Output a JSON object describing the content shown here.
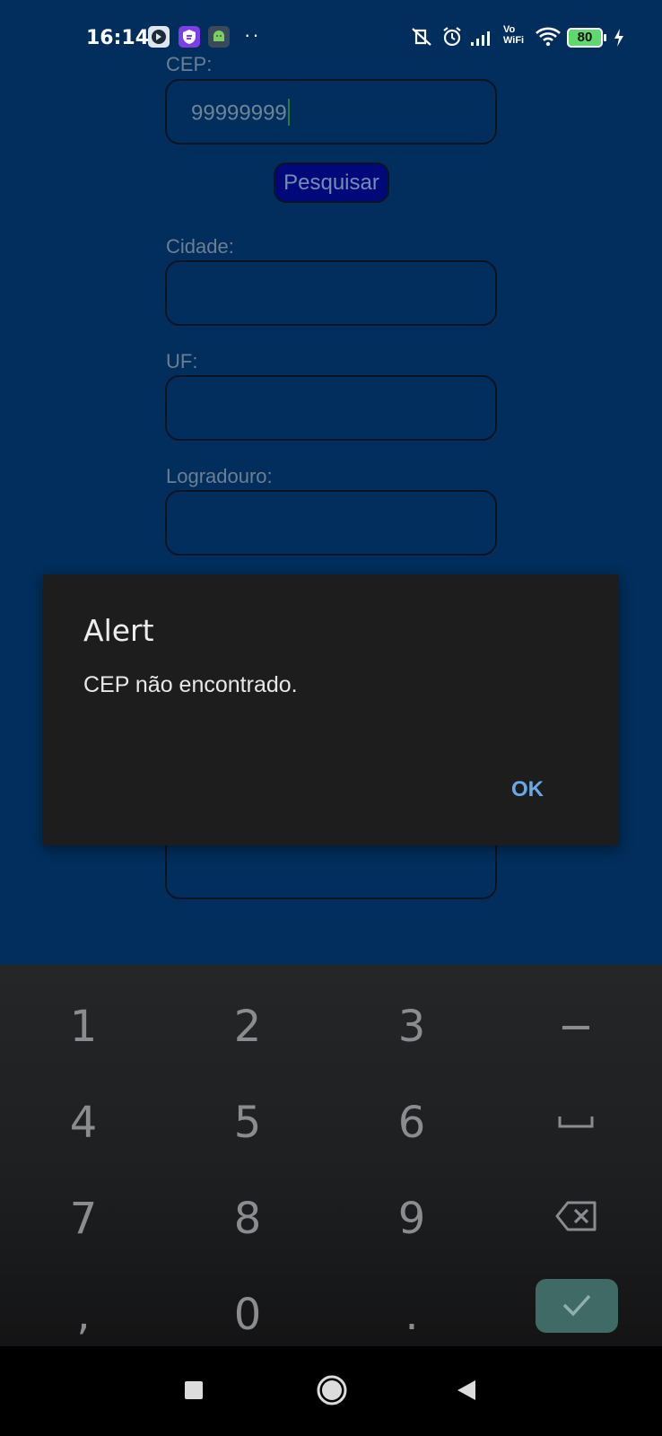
{
  "status_bar": {
    "time": "16:14",
    "notification_icons": [
      "tracker-app-icon",
      "shield-app-icon",
      "android-app-icon"
    ],
    "more_indicator": "··",
    "system_icons": [
      "vibrate-off-icon",
      "alarm-icon",
      "signal-icon",
      "vowifi-icon",
      "wifi-icon",
      "battery-icon",
      "charging-icon"
    ],
    "vowifi_label_top": "Vo",
    "vowifi_label_bottom": "WiFi",
    "battery_level": "80"
  },
  "form": {
    "cep_label": "CEP:",
    "cep_value": "99999999",
    "search_button": "Pesquisar",
    "cidade_label": "Cidade:",
    "cidade_value": "",
    "uf_label": "UF:",
    "uf_value": "",
    "logradouro_label": "Logradouro:",
    "logradouro_value": "",
    "hidden_field_value": ""
  },
  "dialog": {
    "title": "Alert",
    "message": "CEP não encontrado.",
    "ok_label": "OK"
  },
  "keyboard": {
    "rows": [
      [
        "1",
        "2",
        "3",
        "−"
      ],
      [
        "4",
        "5",
        "6",
        "space"
      ],
      [
        "7",
        "8",
        "9",
        "backspace"
      ],
      [
        ",",
        "0",
        ".",
        "enter"
      ]
    ]
  },
  "colors": {
    "background": "#012e5c",
    "dialog": "#1d1d1d",
    "accent": "#6aa9e6",
    "button": "#01087a",
    "enter_key": "#3f6a66"
  }
}
